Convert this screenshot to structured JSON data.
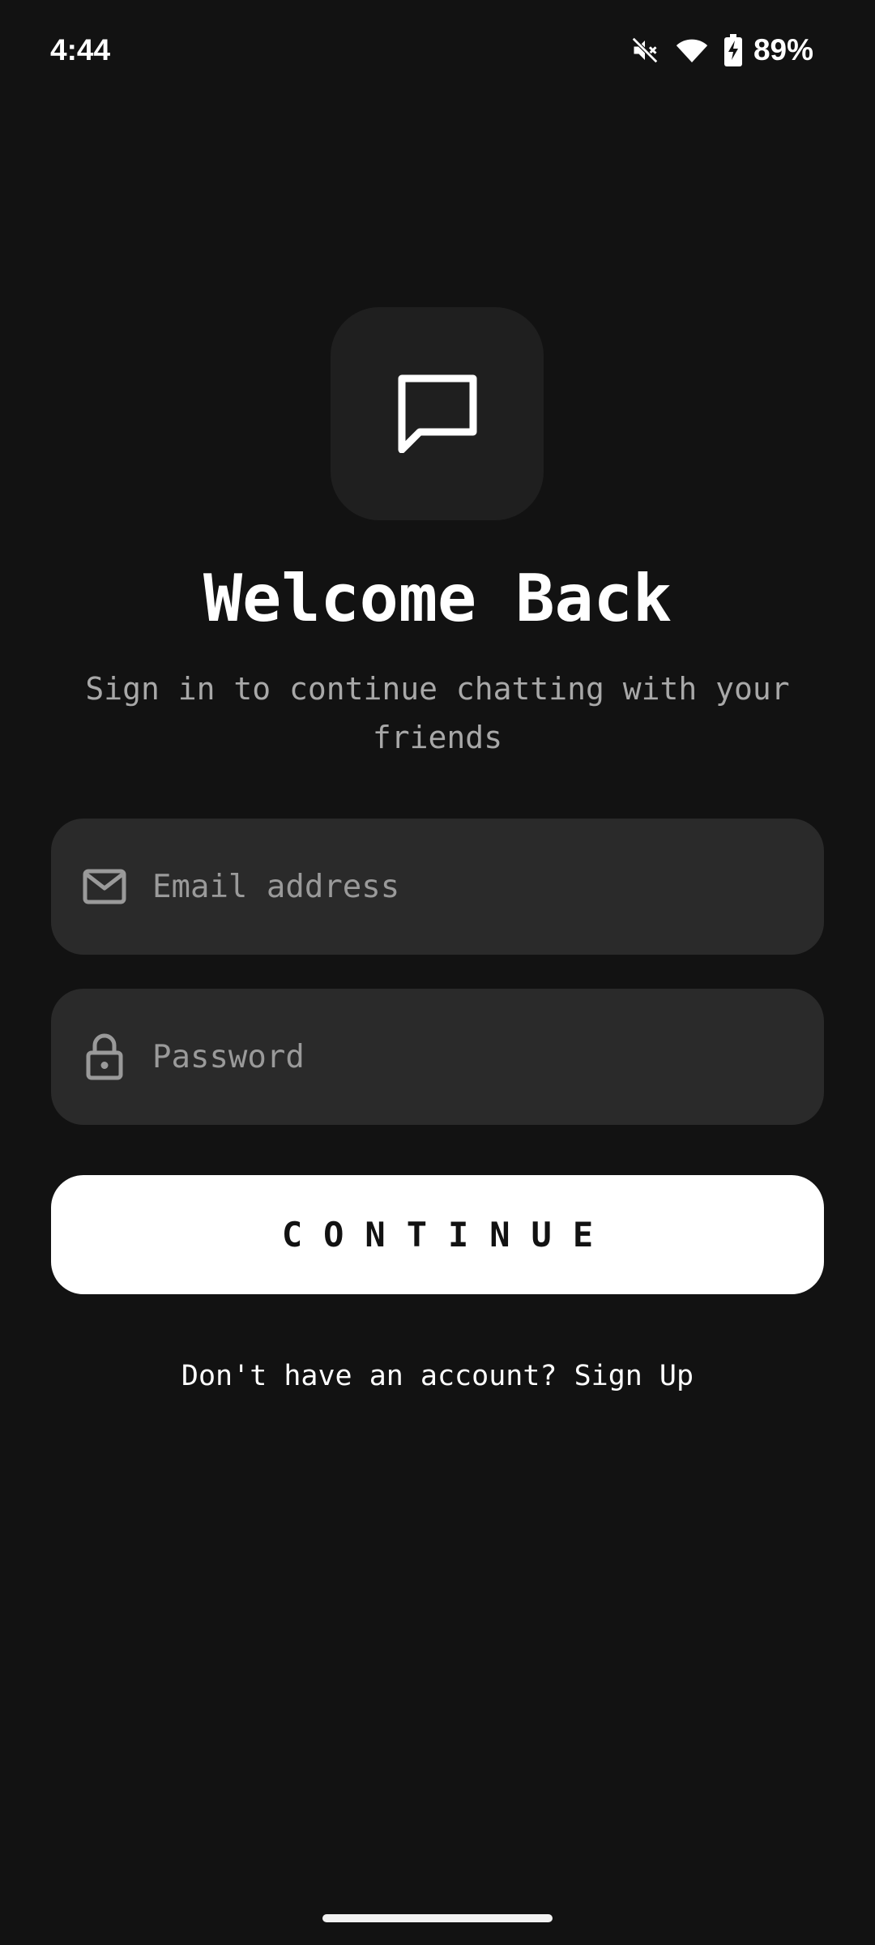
{
  "status_bar": {
    "time": "4:44",
    "battery_percent": "89%",
    "icons": [
      "mute-icon",
      "wifi-icon",
      "battery-charging-icon"
    ]
  },
  "app": {
    "logo_icon": "chat-bubble-icon",
    "title": "Welcome Back",
    "subtitle": "Sign in to continue chatting with your friends"
  },
  "form": {
    "email": {
      "icon": "mail-icon",
      "placeholder": "Email address",
      "value": ""
    },
    "password": {
      "icon": "lock-icon",
      "placeholder": "Password",
      "value": ""
    },
    "continue_label": "CONTINUE"
  },
  "footer": {
    "prompt": "Don't have an account?",
    "signup_label": "Sign Up"
  },
  "colors": {
    "background": "#121212",
    "tile": "#1f1f1f",
    "field": "#2a2a2a",
    "button": "#ffffff",
    "subtitle": "#a8a8a8"
  }
}
